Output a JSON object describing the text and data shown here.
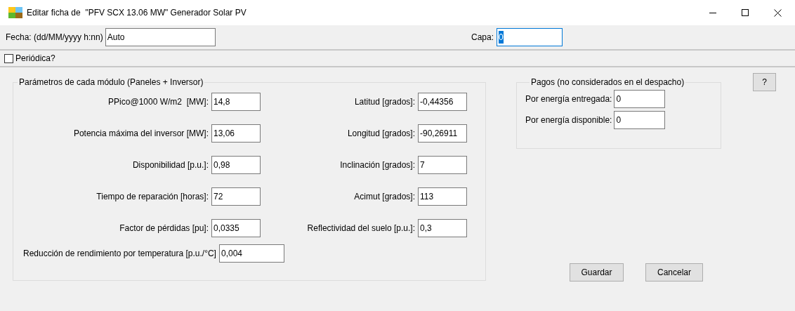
{
  "window": {
    "title": "Editar ficha de  \"PFV SCX 13.06 MW\" Generador Solar PV"
  },
  "fecha": {
    "label": "Fecha: (dd/MM/yyyy h:nn)",
    "value": "Auto"
  },
  "capa": {
    "label": "Capa:",
    "value": "0",
    "focused": true
  },
  "periodica": {
    "label": "Periódica?",
    "checked": false
  },
  "modulo": {
    "title": "Parámetros de cada módulo (Paneles + Inversor)",
    "fields": [
      {
        "label": "PPico@1000 W/m2  [MW]:",
        "value": "14,8"
      },
      {
        "label": "Latitud [grados]:",
        "value": "-0,44356"
      },
      {
        "label": "Potencia máxima del inversor [MW]:",
        "value": "13,06"
      },
      {
        "label": "Longitud [grados]:",
        "value": "-90,26911"
      },
      {
        "label": "Disponibilidad [p.u.]:",
        "value": "0,98"
      },
      {
        "label": "Inclinación [grados]:",
        "value": "7"
      },
      {
        "label": "Tiempo de reparación [horas]:",
        "value": "72"
      },
      {
        "label": "Acimut [grados]:",
        "value": "113"
      },
      {
        "label": "Factor de pérdidas [pu]:",
        "value": "0,0335"
      },
      {
        "label": "Reflectividad del suelo [p.u.]:",
        "value": "0,3"
      }
    ],
    "temperatura": {
      "label": "Reducción de rendimiento por temperatura [p.u./°C]",
      "value": "0,004"
    }
  },
  "pagos": {
    "title": "Pagos (no considerados en el despacho)",
    "fields": [
      {
        "label": "Por energía entregada:",
        "value": "0"
      },
      {
        "label": "Por energía disponible:",
        "value": "0"
      }
    ]
  },
  "help_button": "?",
  "actions": [
    "Guardar",
    "Cancelar"
  ]
}
